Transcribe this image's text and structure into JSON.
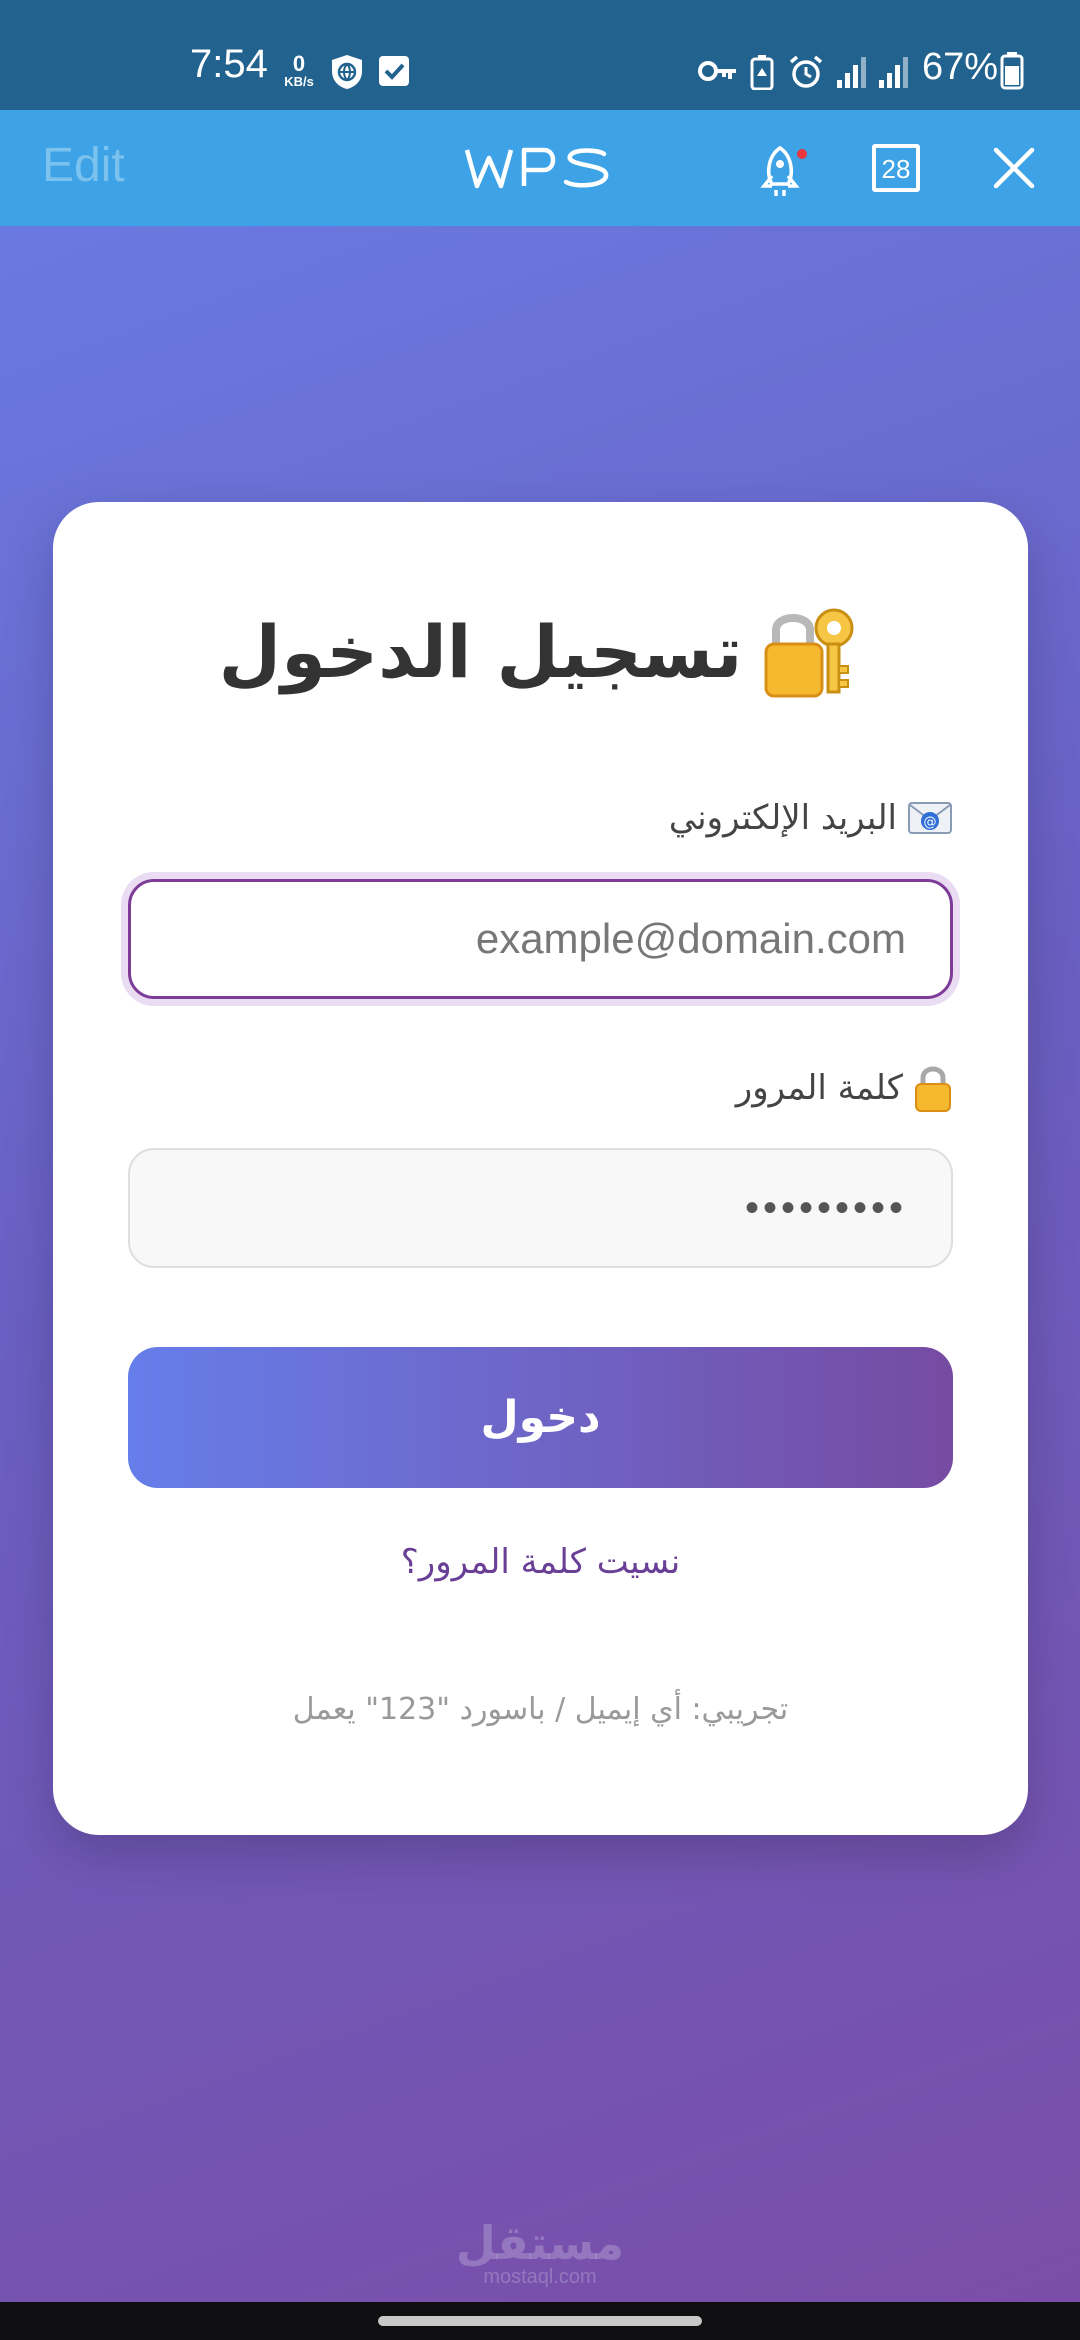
{
  "status_bar": {
    "time": "7:54",
    "net_speed_value": "0",
    "net_speed_unit": "KB/s",
    "battery": "67%"
  },
  "app_header": {
    "edit_label": "Edit",
    "logo_text": "WPS",
    "calendar_day": "28"
  },
  "login": {
    "title": "تسجيل الدخول",
    "email_label": "البريد الإلكتروني",
    "email_placeholder": "example@domain.com",
    "password_label": "كلمة المرور",
    "password_value": "•••••••••",
    "submit_label": "دخول",
    "forgot_label": "نسيت كلمة المرور؟",
    "hint": "تجريبي: أي إيميل / باسورد \"123\" يعمل"
  },
  "watermark": {
    "arabic": "مستقل",
    "latin": "mostaql.com"
  },
  "colors": {
    "status_bar": "#21628f",
    "app_header": "#3da3e6",
    "gradient_start": "#667eea",
    "gradient_end": "#764ba2",
    "link": "#6a3f96"
  }
}
